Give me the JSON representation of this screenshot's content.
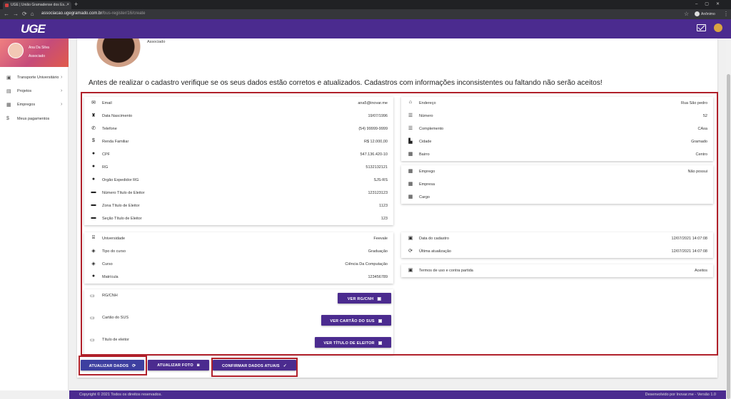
{
  "browser": {
    "tab_title": "UGE | União Gramadense dos Es...",
    "url_domain": "associacao.ugegramado.com.br",
    "url_path": "/bus-register/16/create",
    "profile": "Anônimo"
  },
  "app": {
    "logo": "UGE"
  },
  "user": {
    "name": "Ana Da Silva",
    "role": "Associado"
  },
  "sidebar": {
    "items": [
      {
        "label": "Transporte Universitário",
        "icon": "bus-icon"
      },
      {
        "label": "Projetos",
        "icon": "projects-icon"
      },
      {
        "label": "Empregos",
        "icon": "jobs-icon"
      },
      {
        "label": "Meus pagamentos",
        "icon": "dollar-icon"
      }
    ]
  },
  "profile_role": "Associado",
  "notice": "Antes de realizar o cadastro verifique se os seus dados estão corretos e atualizados. Cadastros com informações inconsistentes ou faltando não serão aceitos!",
  "personal": [
    {
      "label": "Email",
      "value": "ana5@inovar.me",
      "icon": "email-icon"
    },
    {
      "label": "Data Nascimento",
      "value": "19/07/1996",
      "icon": "cake-icon"
    },
    {
      "label": "Telefone",
      "value": "(54) 99999-9999",
      "icon": "phone-icon"
    },
    {
      "label": "Renda Familiar",
      "value": "R$ 12.000,00",
      "icon": "dollar-icon"
    },
    {
      "label": "CPF",
      "value": "547.136.420-10",
      "icon": "person-icon"
    },
    {
      "label": "RG",
      "value": "5132132121",
      "icon": "person-icon"
    },
    {
      "label": "Orgão Expedidor RG",
      "value": "SJS-RS",
      "icon": "person-icon"
    },
    {
      "label": "Número Título de Eleitor",
      "value": "123123123",
      "icon": "card-icon"
    },
    {
      "label": "Zona Título de Eleitor",
      "value": "1123",
      "icon": "card-icon"
    },
    {
      "label": "Seção Título de Eleitor",
      "value": "123",
      "icon": "card-icon"
    }
  ],
  "address": [
    {
      "label": "Endereço",
      "value": "Rua São pedro",
      "icon": "home-icon"
    },
    {
      "label": "Número",
      "value": "52",
      "icon": "list-number-icon"
    },
    {
      "label": "Complemento",
      "value": "CAsa",
      "icon": "list-icon"
    },
    {
      "label": "Cidade",
      "value": "Gramado",
      "icon": "city-icon"
    },
    {
      "label": "Bairro",
      "value": "Centro",
      "icon": "building-icon"
    }
  ],
  "employment": [
    {
      "label": "Emprego",
      "value": "Não possui",
      "icon": "building-icon"
    },
    {
      "label": "Empresa",
      "value": "",
      "icon": "building-icon"
    },
    {
      "label": "Cargo",
      "value": "",
      "icon": "building-icon"
    }
  ],
  "education": [
    {
      "label": "Universidade",
      "value": "Feevale",
      "icon": "university-icon"
    },
    {
      "label": "Tipo do curso",
      "value": "Graduação",
      "icon": "layers-icon"
    },
    {
      "label": "Curso",
      "value": "Ciência Da Computação",
      "icon": "layers-icon"
    },
    {
      "label": "Matrícula",
      "value": "123456789",
      "icon": "person-icon"
    }
  ],
  "dates": [
    {
      "label": "Data do cadastro",
      "value": "12/07/2021 14:07:08",
      "icon": "calendar-icon"
    },
    {
      "label": "Última atualização",
      "value": "12/07/2021 14:07:08",
      "icon": "refresh-icon"
    }
  ],
  "terms": {
    "label": "Termos de uso e contra partida",
    "value": "Aceitos"
  },
  "documents": [
    {
      "label": "RG/CNH",
      "button": "VER RG/CNH"
    },
    {
      "label": "Cartão do SUS",
      "button": "VER CARTÃO DO SUS"
    },
    {
      "label": "Título de eleitor",
      "button": "VER TÍTULO DE ELEITOR"
    }
  ],
  "actions": {
    "update_data": "ATUALIZAR DADOS",
    "update_photo": "ATUALIZAR FOTO",
    "confirm": "CONFIRMAR DADOS ATUAIS"
  },
  "footer": {
    "left": "Copyright © 2021 Todos os direitos reservados.",
    "right": "Desenvolvido por Inovar.me - Versão 1.0"
  }
}
